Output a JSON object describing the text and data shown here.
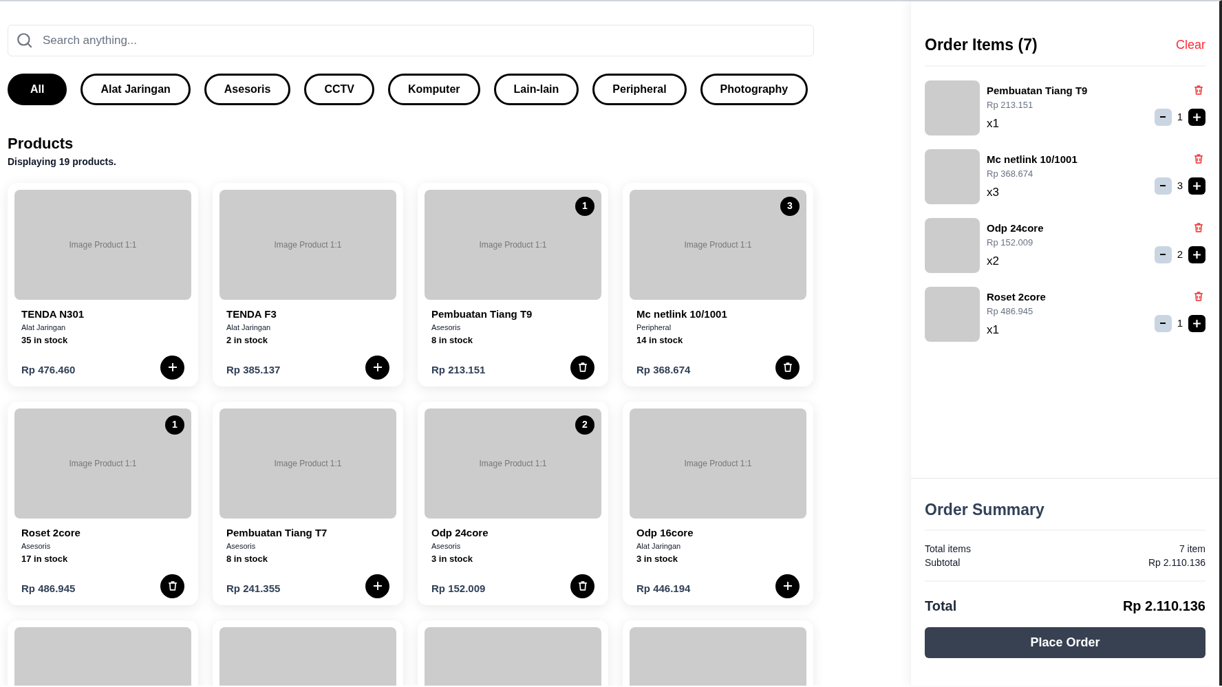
{
  "search": {
    "placeholder": "Search anything..."
  },
  "categories": [
    {
      "label": "All",
      "selected": true
    },
    {
      "label": "Alat Jaringan",
      "selected": false
    },
    {
      "label": "Asesoris",
      "selected": false
    },
    {
      "label": "CCTV",
      "selected": false
    },
    {
      "label": "Komputer",
      "selected": false
    },
    {
      "label": "Lain-lain",
      "selected": false
    },
    {
      "label": "Peripheral",
      "selected": false
    },
    {
      "label": "Photography",
      "selected": false
    }
  ],
  "products_heading": "Products",
  "products_count": "Displaying 19 products.",
  "products": [
    {
      "kind": "full",
      "image_text": "Image Product 1:1",
      "name": "TENDA N301",
      "category": "Alat Jaringan",
      "stock": "35 in stock",
      "price": "Rp 476.460",
      "in_cart": false
    },
    {
      "kind": "full",
      "image_text": "Image Product 1:1",
      "name": "TENDA F3",
      "category": "Alat Jaringan",
      "stock": "2 in stock",
      "price": "Rp 385.137",
      "in_cart": false
    },
    {
      "kind": "full",
      "image_text": "Image Product 1:1",
      "name": "Pembuatan Tiang T9",
      "category": "Asesoris",
      "stock": "8 in stock",
      "price": "Rp 213.151",
      "in_cart": true,
      "badge": "1"
    },
    {
      "kind": "full",
      "image_text": "Image Product 1:1",
      "name": "Mc netlink 10/1001",
      "category": "Peripheral",
      "stock": "14 in stock",
      "price": "Rp 368.674",
      "in_cart": true,
      "badge": "3"
    },
    {
      "kind": "full",
      "image_text": "Image Product 1:1",
      "name": "Roset 2core",
      "category": "Asesoris",
      "stock": "17 in stock",
      "price": "Rp 486.945",
      "in_cart": true,
      "badge": "1"
    },
    {
      "kind": "full",
      "image_text": "Image Product 1:1",
      "name": "Pembuatan Tiang T7",
      "category": "Asesoris",
      "stock": "8 in stock",
      "price": "Rp 241.355",
      "in_cart": false
    },
    {
      "kind": "full",
      "image_text": "Image Product 1:1",
      "name": "Odp 24core",
      "category": "Asesoris",
      "stock": "3 in stock",
      "price": "Rp 152.009",
      "in_cart": true,
      "badge": "2"
    },
    {
      "kind": "full",
      "image_text": "Image Product 1:1",
      "name": "Odp 16core",
      "category": "Alat Jaringan",
      "stock": "3 in stock",
      "price": "Rp 446.194",
      "in_cart": false
    },
    {
      "kind": "cut"
    },
    {
      "kind": "cut"
    },
    {
      "kind": "cut"
    },
    {
      "kind": "cut"
    }
  ],
  "order": {
    "title": "Order Items (7)",
    "clear": "Clear",
    "items": [
      {
        "name": "Pembuatan Tiang T9",
        "price": "Rp 213.151",
        "times": "x1",
        "qty": "1"
      },
      {
        "name": "Mc netlink 10/1001",
        "price": "Rp 368.674",
        "times": "x3",
        "qty": "3"
      },
      {
        "name": "Odp 24core",
        "price": "Rp 152.009",
        "times": "x2",
        "qty": "2"
      },
      {
        "name": "Roset 2core",
        "price": "Rp 486.945",
        "times": "x1",
        "qty": "1"
      }
    ]
  },
  "summary": {
    "title": "Order Summary",
    "rows": [
      {
        "label": "Total items",
        "value": "7 item"
      },
      {
        "label": "Subtotal",
        "value": "Rp 2.110.136"
      }
    ],
    "total_label": "Total",
    "total_value": "Rp 2.110.136",
    "button": "Place Order"
  }
}
